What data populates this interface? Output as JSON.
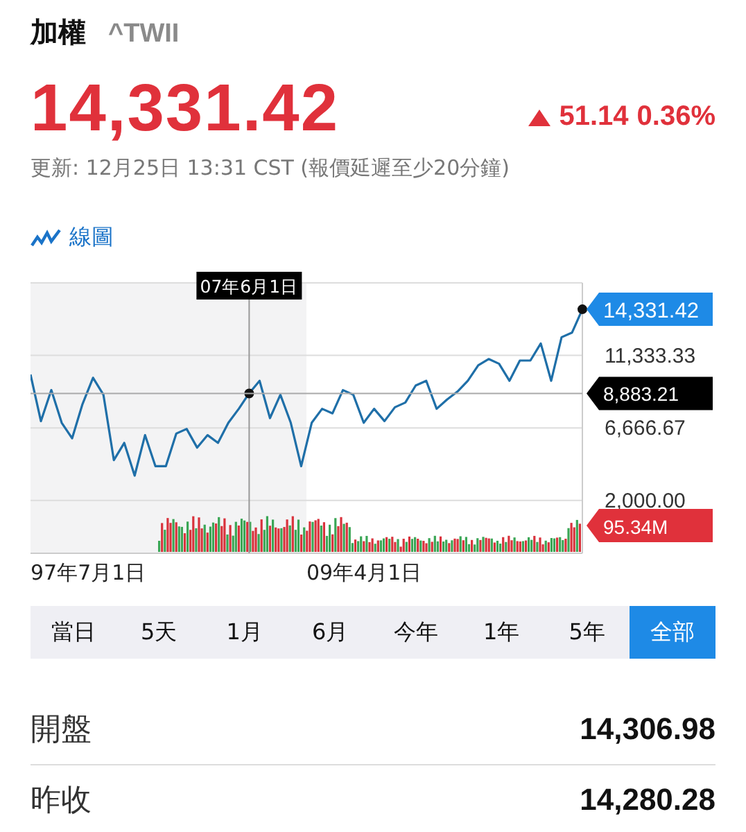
{
  "header": {
    "name": "加權",
    "symbol": "^TWII"
  },
  "quote": {
    "price": "14,331.42",
    "rising": true,
    "change": "51.14",
    "change_percent": "0.36%",
    "updated": "更新: 12月25日 13:31 CST (報價延遲至少20分鐘)"
  },
  "chart": {
    "type_label": "線圖",
    "last_price_label": "14,331.42",
    "crosshair_value_label": "8,883.21",
    "volume_label": "95.34M",
    "x_labels": [
      "97年7月1日",
      "09年4月1日"
    ],
    "chart_data": {
      "type": "line",
      "grid": true,
      "ylim": [
        -1400,
        16000
      ],
      "yticks": [
        {
          "value": 2000,
          "label": "2,000.00"
        },
        {
          "value": 6666.67,
          "label": "6,666.67"
        },
        {
          "value": 11333.33,
          "label": "11,333.33"
        }
      ],
      "series": [
        {
          "color": "#1f6fa8",
          "values": [
            10100,
            7100,
            9100,
            7000,
            6000,
            8200,
            9900,
            8800,
            4600,
            5700,
            3600,
            6200,
            4200,
            4200,
            6300,
            6600,
            5400,
            6200,
            5700,
            7000,
            7900,
            8900,
            9700,
            7300,
            8800,
            7000,
            4200,
            7000,
            7900,
            7600,
            9100,
            8800,
            7000,
            7900,
            7100,
            8000,
            8300,
            9400,
            9700,
            7900,
            8500,
            9000,
            9700,
            10700,
            11100,
            10800,
            9700,
            11000,
            11000,
            12100,
            9700,
            12500,
            12800,
            14300
          ]
        }
      ],
      "ref_lines": [
        {
          "axis": "y",
          "value": 8883.21
        }
      ],
      "annotations": [
        "07年6月1日"
      ]
    }
  },
  "periods": [
    {
      "label": "當日",
      "selected": false
    },
    {
      "label": "5天",
      "selected": false
    },
    {
      "label": "1月",
      "selected": false
    },
    {
      "label": "6月",
      "selected": false
    },
    {
      "label": "今年",
      "selected": false
    },
    {
      "label": "1年",
      "selected": false
    },
    {
      "label": "5年",
      "selected": false
    },
    {
      "label": "全部",
      "selected": true
    }
  ],
  "stats": [
    {
      "label": "開盤",
      "value": "14,306.98"
    },
    {
      "label": "昨收",
      "value": "14,280.28"
    }
  ]
}
